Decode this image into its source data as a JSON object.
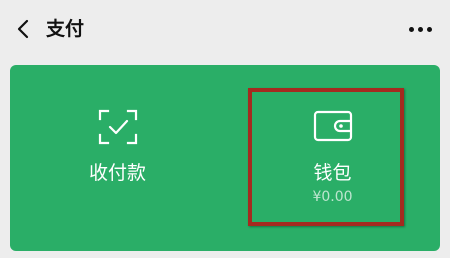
{
  "header": {
    "title": "支付",
    "back_icon": "chevron-left-icon",
    "more_icon": "more-horizontal-icon"
  },
  "card": {
    "background": "#2aae67",
    "items": [
      {
        "label": "收付款",
        "icon": "scan-frame-check-icon"
      },
      {
        "label": "钱包",
        "icon": "wallet-icon",
        "amount": "¥0.00"
      }
    ]
  },
  "highlight_color": "#a52a1f"
}
